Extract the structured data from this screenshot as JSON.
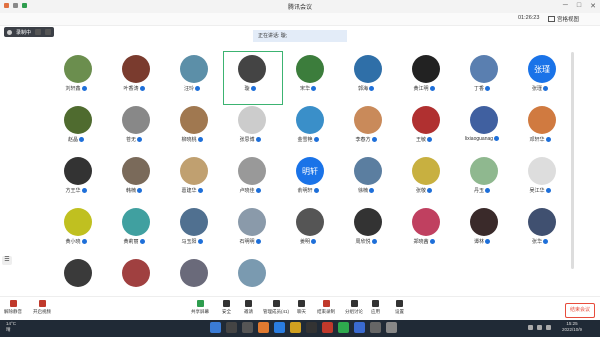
{
  "window": {
    "title": "腾讯会议",
    "controls": [
      "─",
      "□",
      "✕"
    ]
  },
  "header": {
    "timer": "01:26:23",
    "view_label": "宫格视图"
  },
  "record": {
    "label": "录制中"
  },
  "speaking": {
    "label": "正在讲话: 璇;"
  },
  "participants": [
    {
      "name": "刘轩鑫",
      "color": "#6b8e4e"
    },
    {
      "name": "叶香涛",
      "color": "#7a3b2e"
    },
    {
      "name": "汪玲",
      "color": "#5c8fa8"
    },
    {
      "name": "璇",
      "color": "#444",
      "active": true
    },
    {
      "name": "宋华",
      "color": "#3c7d3c"
    },
    {
      "name": "郭海",
      "color": "#2f6fa8"
    },
    {
      "name": "黄江明",
      "color": "#222"
    },
    {
      "name": "丁香",
      "color": "#5a7fb0"
    },
    {
      "name": "张瑾",
      "text": "张瑾"
    },
    {
      "name": "赵晶",
      "color": "#4f6b2f"
    },
    {
      "name": "苍无",
      "color": "#888"
    },
    {
      "name": "柳晓桃",
      "color": "#a07850"
    },
    {
      "name": "张思博",
      "color": "#ccc"
    },
    {
      "name": "金雪艳",
      "color": "#3a8fc9"
    },
    {
      "name": "李春方",
      "color": "#c98a5a"
    },
    {
      "name": "王敏",
      "color": "#b03030"
    },
    {
      "name": "lixiaoguanag",
      "color": "#4060a0"
    },
    {
      "name": "邓轩华",
      "color": "#d07a40"
    },
    {
      "name": "方王华",
      "color": "#333"
    },
    {
      "name": "韩楠",
      "color": "#7a6a5a"
    },
    {
      "name": "葛建华",
      "color": "#c0a070"
    },
    {
      "name": "卢晓佳",
      "color": "#999"
    },
    {
      "name": "俞明轩",
      "text": "明轩"
    },
    {
      "name": "徐楠",
      "color": "#5b7ea0"
    },
    {
      "name": "张敬",
      "color": "#c8b040"
    },
    {
      "name": "丹玉",
      "color": "#8fb88f"
    },
    {
      "name": "吴江华",
      "color": "#ddd"
    },
    {
      "name": "黄小晓",
      "color": "#c0c020"
    },
    {
      "name": "黄莉丽",
      "color": "#40a0a0"
    },
    {
      "name": "马玉阳",
      "color": "#507090"
    },
    {
      "name": "石明明",
      "color": "#8a9aaa"
    },
    {
      "name": "姜明",
      "color": "#555"
    },
    {
      "name": "周欣悦",
      "color": "#333"
    },
    {
      "name": "郑晓茜",
      "color": "#c04060"
    },
    {
      "name": "谭林",
      "color": "#3a2a2a"
    },
    {
      "name": "张华",
      "color": "#405070"
    },
    {
      "name": "",
      "color": "#3a3a3a"
    },
    {
      "name": "",
      "color": "#a04040"
    },
    {
      "name": "",
      "color": "#6a6a7a"
    },
    {
      "name": "",
      "color": "#7a9ab0"
    }
  ],
  "bottom": {
    "mute": "解除静音",
    "video": "开启视频",
    "share": "共享屏幕",
    "security": "安全",
    "invite": "邀请",
    "members": "管理成员(41)",
    "chat": "聊天",
    "record": "结束录制",
    "groups": "分组讨论",
    "apps": "应用",
    "settings": "设置",
    "leave": "结束会议"
  },
  "taskbar": {
    "temp": "14°C",
    "weather": "晴",
    "time": "15:25",
    "date": "2022/10/9"
  }
}
